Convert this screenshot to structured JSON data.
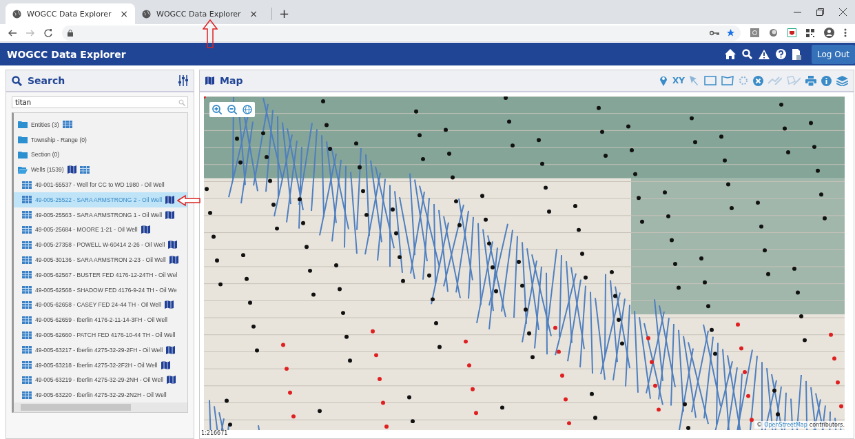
{
  "browser": {
    "tabs": [
      {
        "title": "WOGCC Data Explorer",
        "close": "×",
        "selected": true
      },
      {
        "title": "WOGCC Data Explorer",
        "close": "×",
        "selected": false
      }
    ],
    "new_tab": "+"
  },
  "app": {
    "title": "WOGCC Data Explorer",
    "logout": "Log Out"
  },
  "search": {
    "title": "Search",
    "value": "titan",
    "tree": [
      {
        "kind": "folder",
        "label": "Entities (3)",
        "expanded": false,
        "selected": false,
        "map_link": false,
        "table_link": true
      },
      {
        "kind": "folder",
        "label": "Township - Range (0)",
        "expanded": false,
        "selected": false,
        "map_link": false,
        "table_link": false
      },
      {
        "kind": "folder",
        "label": "Section (0)",
        "expanded": false,
        "selected": false,
        "map_link": false,
        "table_link": false
      },
      {
        "kind": "folder",
        "label": "Wells (1539)",
        "expanded": true,
        "selected": false,
        "map_link": true,
        "table_link": true,
        "children": [
          {
            "kind": "well",
            "label": "49-001-55537 - Well for CC to WD 1980 - Oil Well",
            "selected": false,
            "map_link": false
          },
          {
            "kind": "well",
            "label": "49-005-25522 - SARA ARMSTRONG 2 - Oil Well",
            "selected": true,
            "map_link": true
          },
          {
            "kind": "well",
            "label": "49-005-25563 - SARA ARMSTRONG 1 - Oil Well",
            "selected": false,
            "map_link": true
          },
          {
            "kind": "well",
            "label": "49-005-25684 - MOORE 1-21 - Oil Well",
            "selected": false,
            "map_link": true
          },
          {
            "kind": "well",
            "label": "49-005-27358 - POWELL W-60414 2-26 - Oil Well",
            "selected": false,
            "map_link": true
          },
          {
            "kind": "well",
            "label": "49-005-30136 - SARA ARMSTRON 2-23 - Oil Well",
            "selected": false,
            "map_link": true
          },
          {
            "kind": "well",
            "label": "49-005-62567 - BUSTER FED 4176-12-24TH - Oil Wel",
            "selected": false,
            "map_link": false
          },
          {
            "kind": "well",
            "label": "49-005-62568 - SHADOW FED 4176-9-24 TH - Oil We",
            "selected": false,
            "map_link": false
          },
          {
            "kind": "well",
            "label": "49-005-62658 - CASEY FED 24-44 TH - Oil Well",
            "selected": false,
            "map_link": true
          },
          {
            "kind": "well",
            "label": "49-005-62659 - Iberlin 4176-2-11-14-3FH - Oil Well",
            "selected": false,
            "map_link": false
          },
          {
            "kind": "well",
            "label": "49-005-62660 - PATCH FED 4176-10-44 TH - Oil Well",
            "selected": false,
            "map_link": false
          },
          {
            "kind": "well",
            "label": "49-005-63217 - Iberlin 4275-32-29-2FH - Oil Well",
            "selected": false,
            "map_link": true
          },
          {
            "kind": "well",
            "label": "49-005-63218 - Iberlin 4275-32-2F2H - Oil Well",
            "selected": false,
            "map_link": true
          },
          {
            "kind": "well",
            "label": "49-005-63219 - Iberlin 4275-32-29-2NH - Oil Well",
            "selected": false,
            "map_link": true
          },
          {
            "kind": "well",
            "label": "49-005-63220 - Iberlin 4275-32-29-2N2H - Oil Well",
            "selected": false,
            "map_link": false
          }
        ]
      }
    ]
  },
  "map": {
    "title": "Map",
    "xy_tool": "XY",
    "attribution_symbol": "©",
    "attribution_link": "OpenStreetMap",
    "attribution_text": "contributors.",
    "scale": "1:216671"
  }
}
